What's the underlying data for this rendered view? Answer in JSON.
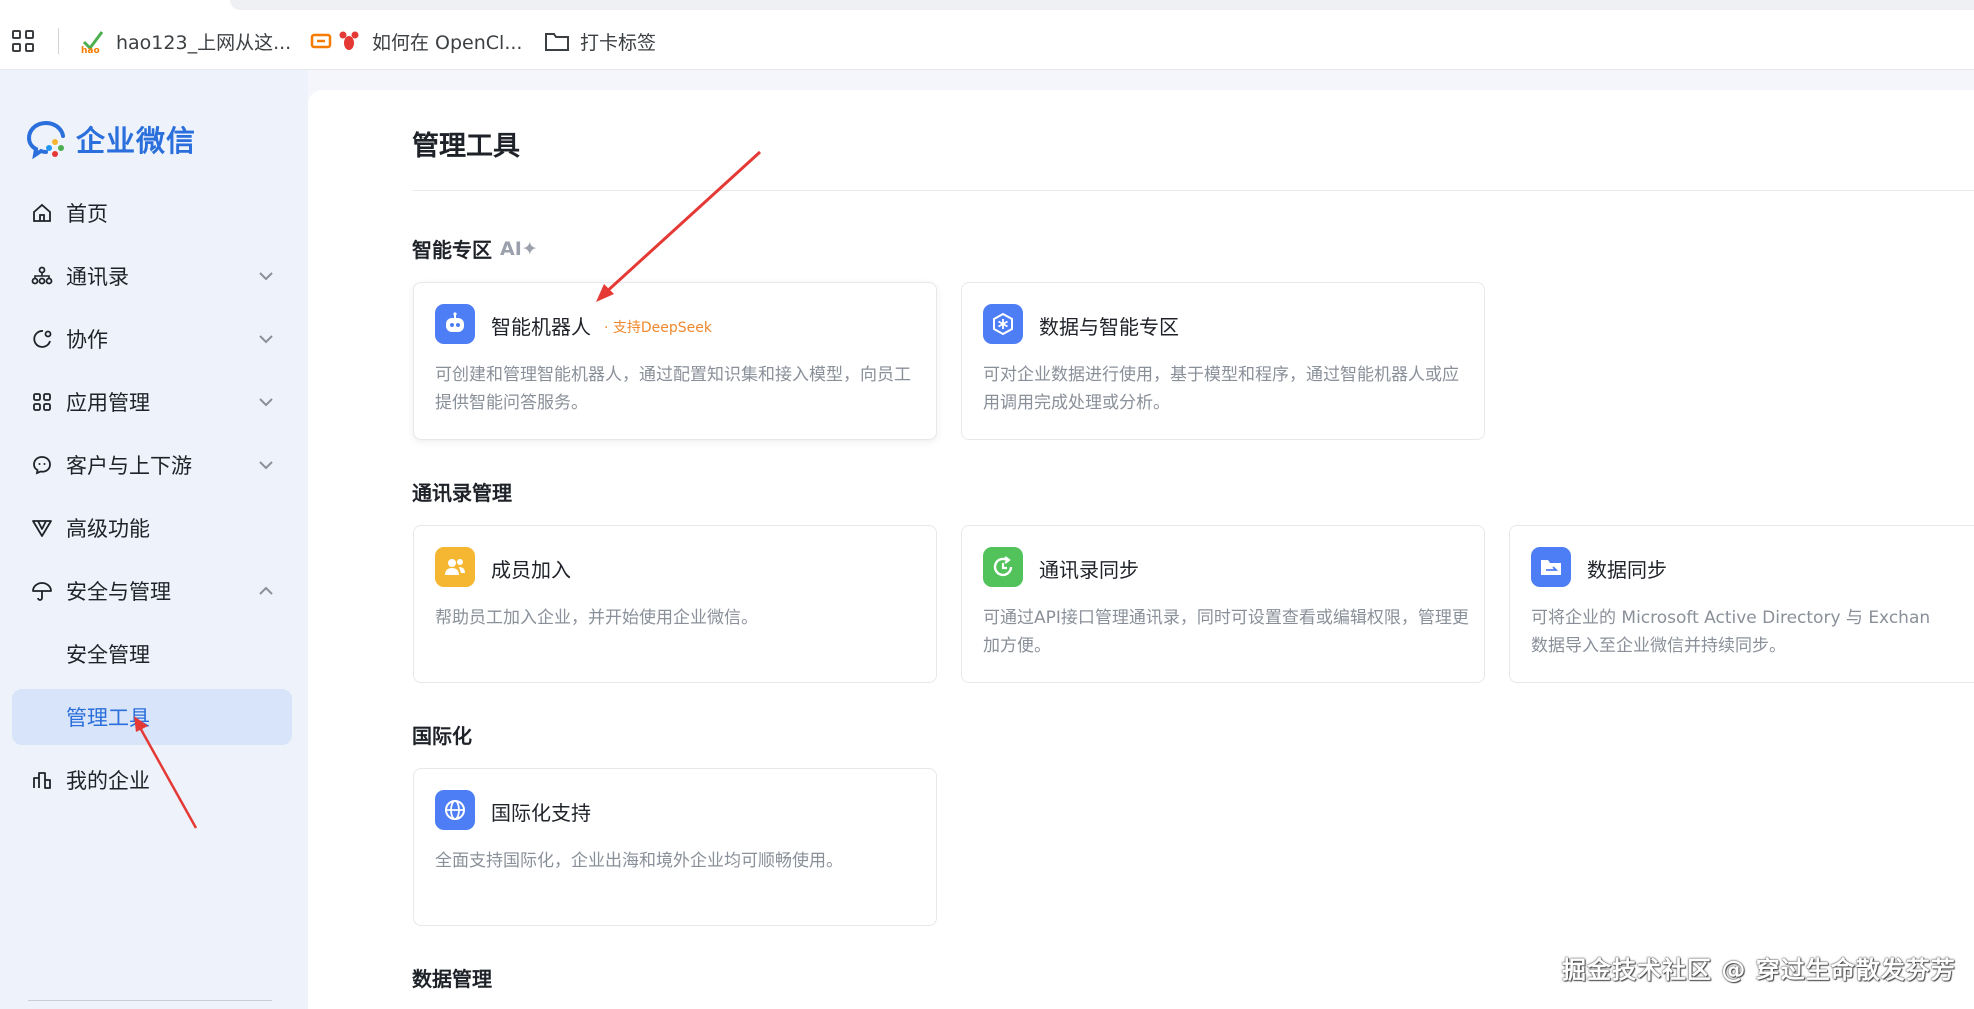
{
  "bookmarks": {
    "items": [
      {
        "label": "hao123_上网从这...",
        "icon": "hao123-icon"
      },
      {
        "label": "如何在 OpenCl...",
        "icon": "lobster-icon"
      },
      {
        "label": "打卡标签",
        "icon": "folder-icon"
      }
    ],
    "hao_icon_text": "hao"
  },
  "sidebar": {
    "logo_text": "企业微信",
    "items": [
      {
        "label": "首页",
        "icon": "home-icon"
      },
      {
        "label": "通讯录",
        "icon": "org-chart-icon",
        "expandable": true
      },
      {
        "label": "协作",
        "icon": "collab-icon",
        "expandable": true
      },
      {
        "label": "应用管理",
        "icon": "apps-grid-icon",
        "expandable": true
      },
      {
        "label": "客户与上下游",
        "icon": "chat-smile-icon",
        "expandable": true
      },
      {
        "label": "高级功能",
        "icon": "diamond-icon"
      },
      {
        "label": "安全与管理",
        "icon": "umbrella-icon",
        "expandable": true,
        "expanded": true
      },
      {
        "label": "安全管理",
        "sub": true
      },
      {
        "label": "管理工具",
        "sub": true,
        "active": true
      },
      {
        "label": "我的企业",
        "icon": "building-icon"
      }
    ]
  },
  "main": {
    "title": "管理工具",
    "sections": [
      {
        "title": "智能专区",
        "badge": "AI",
        "cards": [
          {
            "name": "智能机器人",
            "tag": "· 支持DeepSeek",
            "desc": "可创建和管理智能机器人，通过配置知识集和接入模型，向员工提供智能问答服务。",
            "icon": "robot-icon",
            "color": "#4e7ef5"
          },
          {
            "name": "数据与智能专区",
            "desc": "可对企业数据进行使用，基于模型和程序，通过智能机器人或应用调用完成处理或分析。",
            "icon": "snowflake-cube-icon",
            "color": "#4e7ef5"
          }
        ]
      },
      {
        "title": "通讯录管理",
        "cards": [
          {
            "name": "成员加入",
            "desc": "帮助员工加入企业，并开始使用企业微信。",
            "icon": "member-join-icon",
            "color": "#f5b731"
          },
          {
            "name": "通讯录同步",
            "desc": "可通过API接口管理通讯录，同时可设置查看或编辑权限，管理更加方便。",
            "icon": "sync-clock-icon",
            "color": "#52c25a"
          },
          {
            "name": "数据同步",
            "desc_line1": "可将企业的 Microsoft Active Directory 与 Exchan",
            "desc_line2": "数据导入至企业微信并持续同步。",
            "icon": "folder-sync-icon",
            "color": "#4e7ef5"
          }
        ]
      },
      {
        "title": "国际化",
        "cards": [
          {
            "name": "国际化支持",
            "desc": "全面支持国际化，企业出海和境外企业均可顺畅使用。",
            "icon": "globe-icon",
            "color": "#4e7ef5"
          }
        ]
      },
      {
        "title": "数据管理",
        "cards": []
      }
    ]
  },
  "watermark": "掘金技术社区 @ 穿过生命散发芬芳",
  "colors": {
    "accent": "#2a6fdb",
    "sidebar_bg": "#eef2fb",
    "active_bg": "#d7e4f9",
    "annotation_arrow": "#e53935",
    "tag_orange": "#f0882e"
  }
}
